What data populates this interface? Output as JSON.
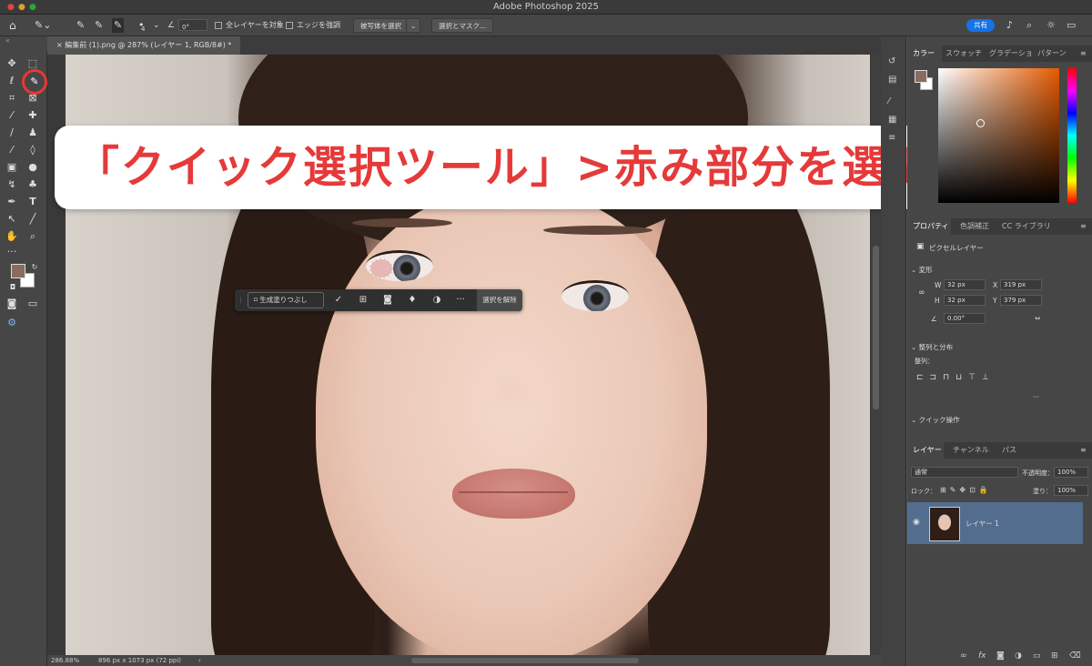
{
  "app": {
    "title": "Adobe Photoshop 2025"
  },
  "options": {
    "brush_size": "4",
    "angle": "0°",
    "sample_all": "全レイヤーを対象",
    "enhance_edge": "エッジを強調",
    "select_subject": "被写体を選択",
    "select_mask": "選択とマスク...",
    "share": "共有"
  },
  "document": {
    "tab": "編集前 (1).png @ 287% (レイヤー 1, RGB/8#) *"
  },
  "banner": {
    "text": "「クイック選択ツール」>赤み部分を選択",
    "color": "#e53a3a"
  },
  "context_bar": {
    "generative_fill": "生成塗りつぶし",
    "deselect": "選択を解除"
  },
  "status": {
    "zoom": "286.88%",
    "info": "896 px x 1073 px (72 ppi)"
  },
  "color_panel": {
    "tabs": [
      "カラー",
      "スウォッチ",
      "グラデーショ",
      "パターン"
    ],
    "foreground": "#8a6b60",
    "background": "#ffffff"
  },
  "properties": {
    "tabs": [
      "プロパティ",
      "色調補正",
      "CC ライブラリ"
    ],
    "type": "ピクセルレイヤー",
    "transform_header": "変形",
    "w_label": "W",
    "w": "32 px",
    "h_label": "H",
    "h": "32 px",
    "x_label": "X",
    "x": "319 px",
    "y_label": "Y",
    "y": "379 px",
    "angle": "0.00°",
    "align_header": "整列と分布",
    "align_label": "整列：",
    "quick_actions": "クイック操作"
  },
  "layers": {
    "tabs": [
      "レイヤー",
      "チャンネル",
      "パス"
    ],
    "blend": "通常",
    "opacity_label": "不透明度：",
    "opacity": "100%",
    "lock_label": "ロック：",
    "fill_label": "塗り：",
    "fill": "100%",
    "layer_name": "レイヤー 1"
  }
}
